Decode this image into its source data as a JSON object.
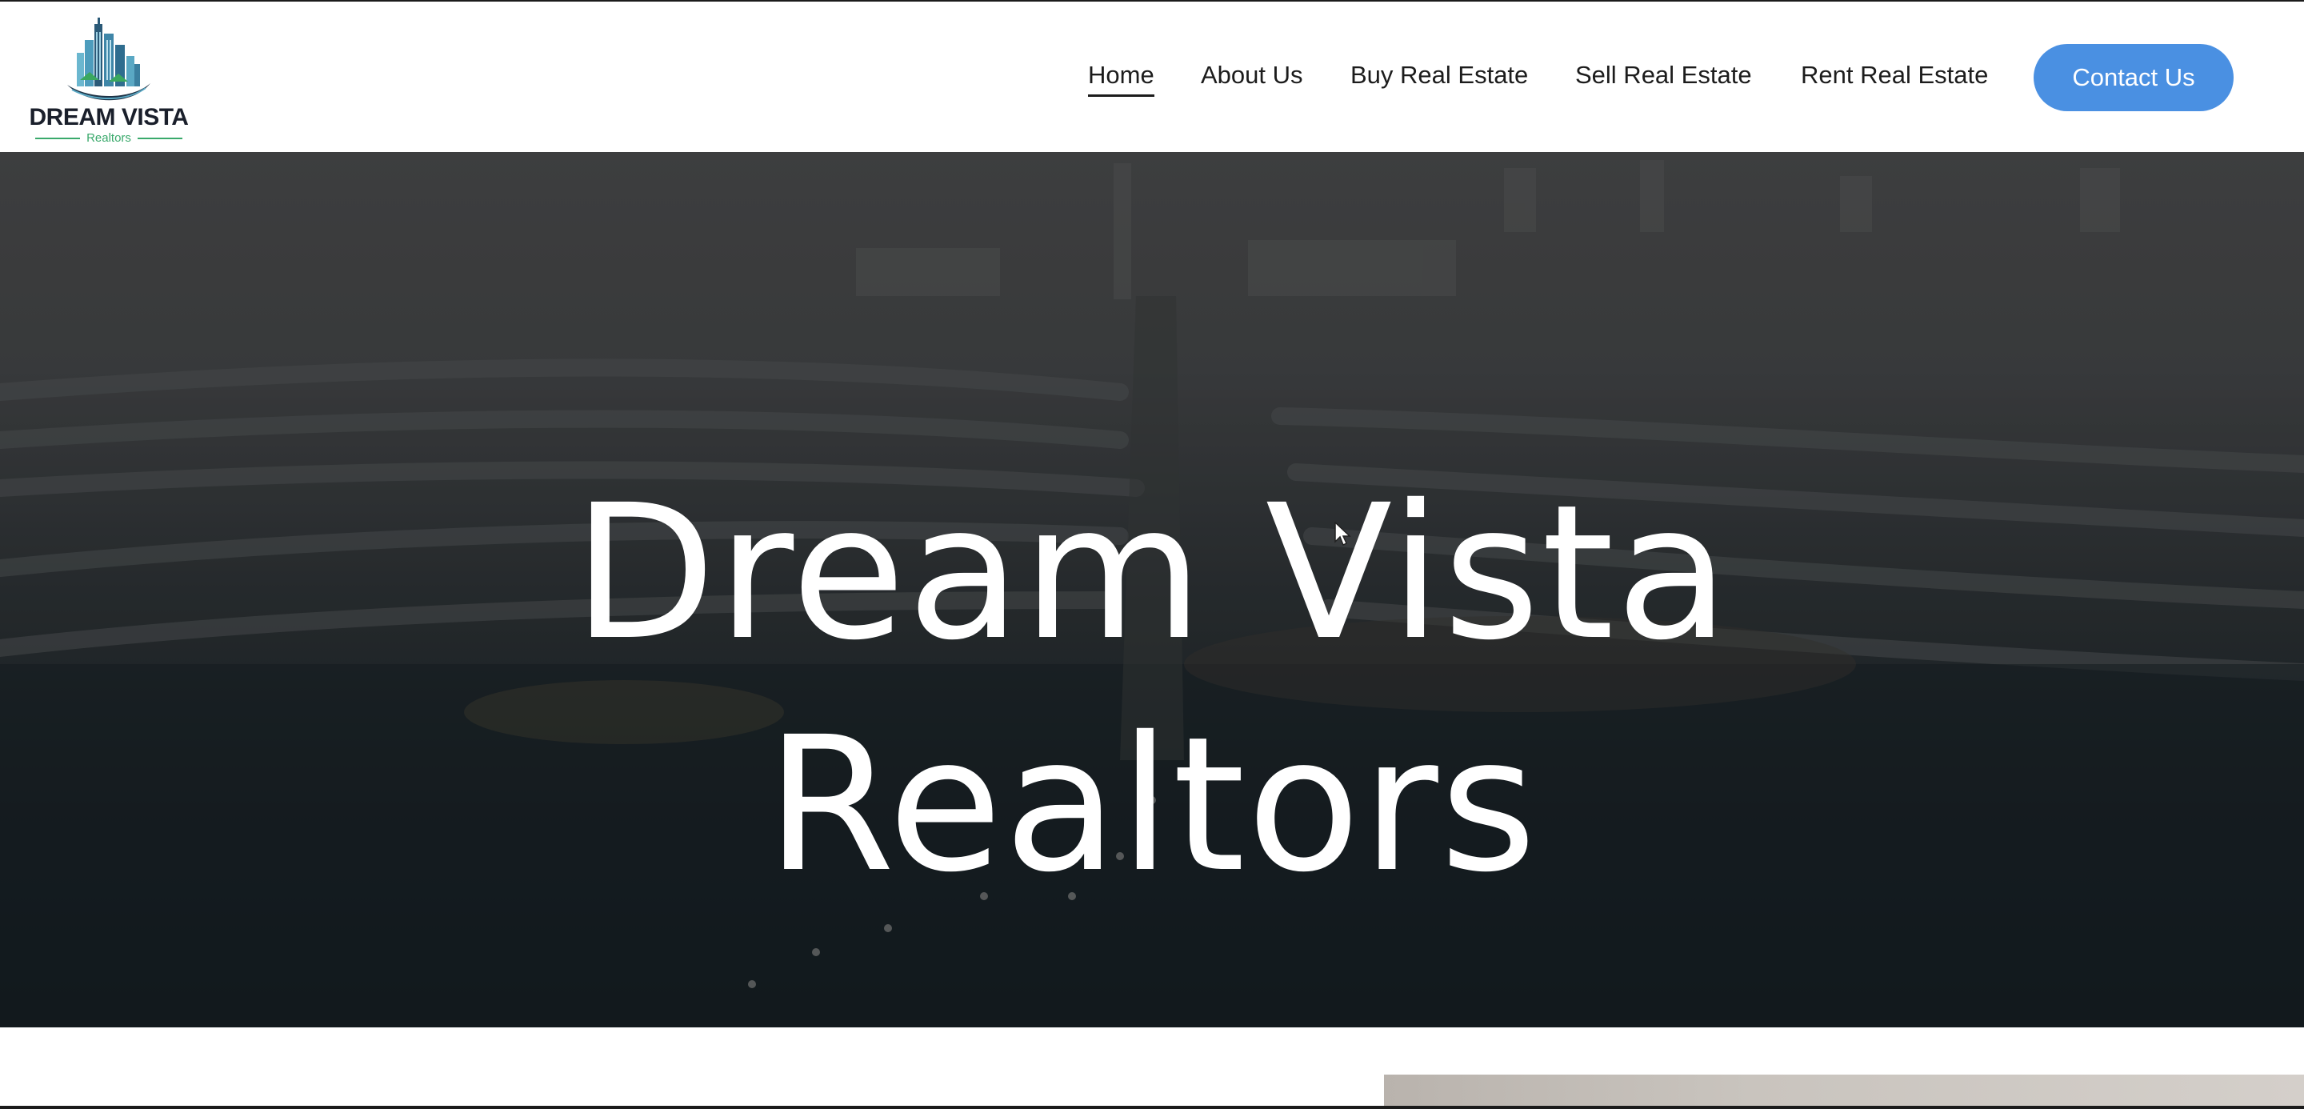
{
  "brand": {
    "logo_title": "DREAM VISTA",
    "logo_subtitle": "Realtors"
  },
  "nav": {
    "items": [
      {
        "label": "Home",
        "active": true
      },
      {
        "label": "About Us",
        "active": false
      },
      {
        "label": "Buy Real Estate",
        "active": false
      },
      {
        "label": "Sell Real Estate",
        "active": false
      },
      {
        "label": "Rent Real Estate",
        "active": false
      }
    ],
    "cta_label": "Contact Us"
  },
  "hero": {
    "title_line1": "Dream Vista",
    "title_line2": "Realtors",
    "background_image": "aerial-palm-island-coastline"
  },
  "colors": {
    "accent": "#4a90e2",
    "logo_green": "#39a96b",
    "text_dark": "#1c1c1c",
    "hero_text": "#ffffff"
  },
  "icons": {
    "cursor": "pointer-cursor-icon",
    "logo": "city-skyline-logo-icon"
  }
}
